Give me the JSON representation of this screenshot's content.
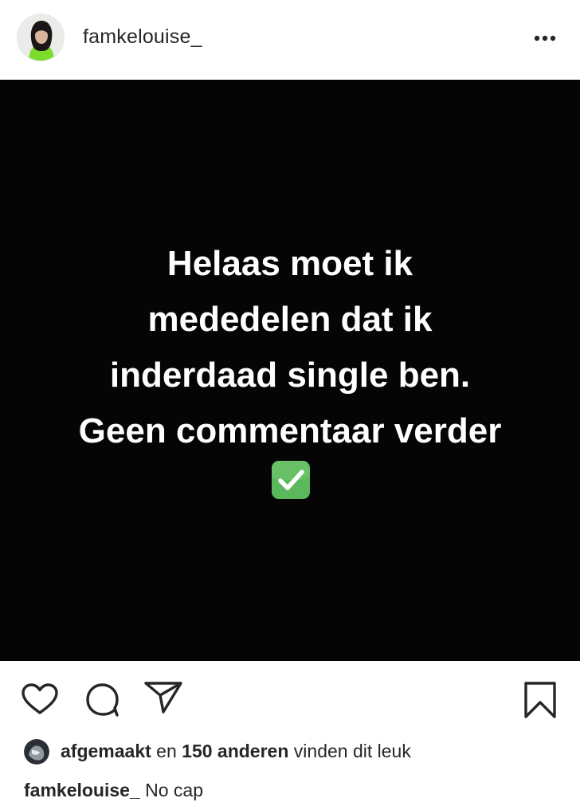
{
  "header": {
    "username": "famkelouise_",
    "avatar_icon": "profile-avatar",
    "more_icon": "more-options-icon"
  },
  "post": {
    "background": "#050505",
    "text_color": "#ffffff",
    "lines": [
      "Helaas moet ik",
      "mededelen dat ik",
      "inderdaad single ben.",
      "Geen commentaar verder"
    ],
    "emoji": "check-mark-button-emoji",
    "emoji_color": "#5cb85c"
  },
  "actions": {
    "like_icon": "heart-icon",
    "comment_icon": "comment-icon",
    "share_icon": "send-icon",
    "save_icon": "bookmark-icon"
  },
  "likes": {
    "user": "afgemaakt",
    "middle": " en ",
    "others": "150 anderen",
    "suffix": " vinden dit leuk"
  },
  "caption": {
    "username": "famkelouise_",
    "text": " No cap"
  }
}
